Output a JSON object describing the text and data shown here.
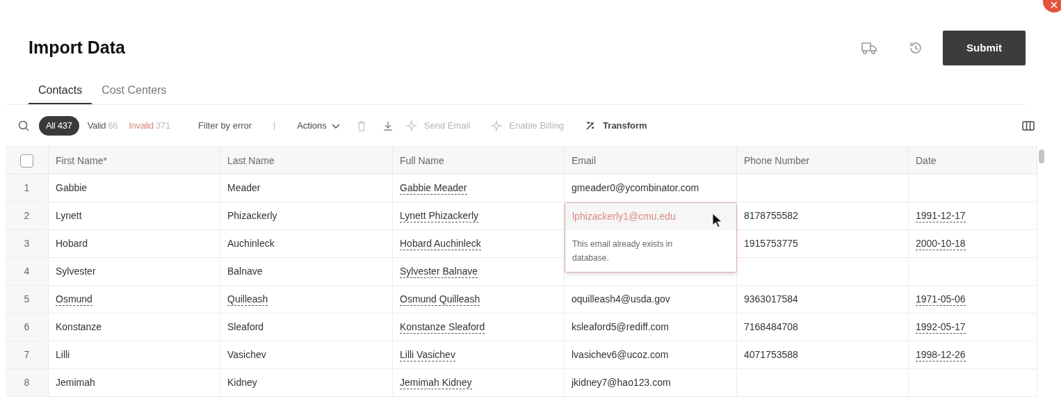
{
  "header": {
    "title": "Import Data",
    "submit": "Submit"
  },
  "tabs": [
    {
      "label": "Contacts",
      "selected": true
    },
    {
      "label": "Cost Centers",
      "selected": false
    }
  ],
  "filters": [
    {
      "label": "All",
      "count": "437",
      "kind": "all",
      "selected": true
    },
    {
      "label": "Valid",
      "count": "66",
      "kind": "valid",
      "selected": false
    },
    {
      "label": "Invalid",
      "count": "371",
      "kind": "invalid",
      "selected": false
    }
  ],
  "filter_by_error": "Filter by error",
  "actions": "Actions",
  "toolbar_actions": [
    {
      "label": "Send Email",
      "kind": "sparkle",
      "disabled": true
    },
    {
      "label": "Enable Billing",
      "kind": "sparkle",
      "disabled": true
    },
    {
      "label": "Transform",
      "kind": "wand",
      "disabled": false
    }
  ],
  "table": {
    "select_all": {
      "checked": false
    },
    "columns": [
      "First Name*",
      "Last Name",
      "Full Name",
      "Email",
      "Phone Number",
      "Date"
    ],
    "rows": [
      {
        "index": "1",
        "cells": [
          {
            "text": "Gabbie"
          },
          {
            "text": "Meader"
          },
          {
            "text": "Gabbie Meader",
            "flagged": true
          },
          {
            "text": "gmeader0@ycombinator.com"
          },
          {},
          {}
        ]
      },
      {
        "index": "2",
        "cells": [
          {
            "text": "Lynett"
          },
          {
            "text": "Phizackerly"
          },
          {
            "text": "Lynett Phizackerly",
            "flagged": true
          },
          {
            "text": "lphizackerly1@cmu.edu",
            "error": "This email already exists in database."
          },
          {
            "text": "8178755582"
          },
          {
            "text": "1991-12-17",
            "flagged": true
          }
        ]
      },
      {
        "index": "3",
        "cells": [
          {
            "text": "Hobard"
          },
          {
            "text": "Auchinleck"
          },
          {
            "text": "Hobard Auchinleck",
            "flagged": true
          },
          {},
          {
            "text": "1915753775"
          },
          {
            "text": "2000-10-18",
            "flagged": true
          }
        ]
      },
      {
        "index": "4",
        "cells": [
          {
            "text": "Sylvester"
          },
          {
            "text": "Balnave"
          },
          {
            "text": "Sylvester Balnave",
            "flagged": true
          },
          {},
          {},
          {}
        ]
      },
      {
        "index": "5",
        "cells": [
          {
            "text": "Osmund",
            "flagged": true
          },
          {
            "text": "Quilleash",
            "flagged": true
          },
          {
            "text": "Osmund Quilleash",
            "flagged": true
          },
          {
            "text": "oquilleash4@usda.gov"
          },
          {
            "text": "9363017584"
          },
          {
            "text": "1971-05-06",
            "flagged": true
          }
        ]
      },
      {
        "index": "6",
        "cells": [
          {
            "text": "Konstanze"
          },
          {
            "text": "Sleaford"
          },
          {
            "text": "Konstanze Sleaford",
            "flagged": true
          },
          {
            "text": "ksleaford5@rediff.com"
          },
          {
            "text": "7168484708"
          },
          {
            "text": "1992-05-17",
            "flagged": true
          }
        ]
      },
      {
        "index": "7",
        "cells": [
          {
            "text": "Lilli"
          },
          {
            "text": "Vasichev"
          },
          {
            "text": "Lilli Vasichev",
            "flagged": true
          },
          {
            "text": "lvasichev6@ucoz.com"
          },
          {
            "text": "4071753588"
          },
          {
            "text": "1998-12-26",
            "flagged": true
          }
        ]
      },
      {
        "index": "8",
        "cells": [
          {
            "text": "Jemimah"
          },
          {
            "text": "Kidney"
          },
          {
            "text": "Jemimah Kidney",
            "flagged": true
          },
          {
            "text": "jkidney7@hao123.com"
          },
          {},
          {}
        ]
      }
    ]
  }
}
